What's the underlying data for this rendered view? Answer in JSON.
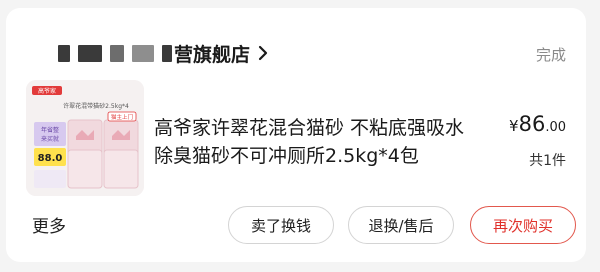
{
  "order": {
    "shop_name": "营旗舰店",
    "status": "完成",
    "product": {
      "title": "高爷家许翠花混合猫砂 不粘底强吸水除臭猫砂不可冲厕所2.5kg*4包",
      "price_currency": "¥",
      "price_int": "86",
      "price_dec": ".00",
      "quantity": "共1件",
      "thumb": {
        "brand_tag": "高爷家",
        "banner": "许翠花混带猫砂2.5kg*4",
        "promo_line1": "年省整",
        "promo_line2": "来买就",
        "promo_price": "88.0",
        "badge": "猫主上门"
      }
    },
    "more_label": "更多",
    "buttons": {
      "sell": "卖了换钱",
      "refund": "退换/售后",
      "rebuy": "再次购买"
    }
  },
  "colors": {
    "accent": "#e0312b",
    "status_gray": "#8a8a8a"
  }
}
